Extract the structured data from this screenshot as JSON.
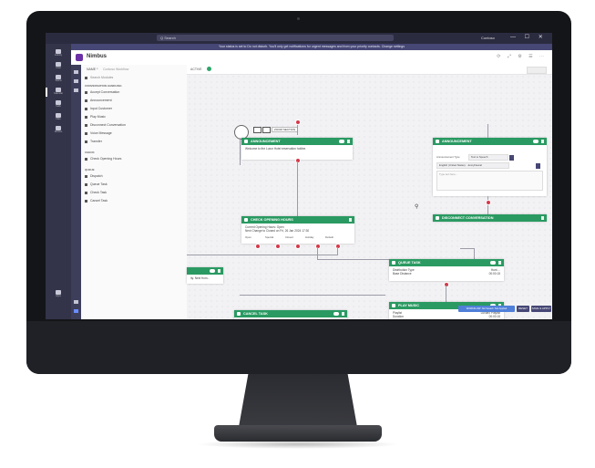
{
  "titlebar": {
    "search_placeholder": "Q Search",
    "user": "Contoso",
    "window_buttons": "— ☐ ✕"
  },
  "banner": {
    "text": "Your status is set to Do not disturb. You'll only get notifications for urgent messages and from your priority contacts. Change settings"
  },
  "app": {
    "name": "Nimbus",
    "header_icons": "⟳ ⤢ ⚙ ☰ ⋯"
  },
  "rail": {
    "items": [
      "Activity",
      "Chat",
      "Teams",
      "Calendar",
      "Calls",
      "Files",
      "Nimbus",
      "Apps"
    ]
  },
  "toolbar": {
    "active_label": "ACTIVE",
    "name_label": "NAME *",
    "name_value": "Contoso Workflow"
  },
  "sidebar": {
    "search_placeholder": "Search Modules",
    "sections": [
      {
        "title": "CONVERSATION HANDLING",
        "items": [
          "Accept Conversation",
          "Announcement",
          "Input Customer",
          "Play Music",
          "Disconnect Conversation",
          "Voice Message",
          "Transfer"
        ]
      },
      {
        "title": "CHECK",
        "items": [
          "Check Opening Hours"
        ]
      },
      {
        "title": "QUEUE",
        "items": [
          "Dispatch",
          "Queue Task",
          "Check Task",
          "Cancel Task"
        ]
      }
    ]
  },
  "nodes": {
    "start_zoom": "ZOOM SECTION",
    "announcement1": {
      "title": "ANNOUNCEMENT",
      "body": "Welcome to the Luxor Hotel reservation hotline."
    },
    "announcement2": {
      "title": "ANNOUNCEMENT",
      "type_label": "Announcement Type",
      "type_value": "Text to Speech",
      "lang_value": "English (United States) · JennyNeural",
      "placeholder": "Type text here..."
    },
    "opening_hours": {
      "title": "CHECK OPENING HOURS",
      "line1": "Current Opening Hours: Open",
      "line2": "Next Change to Closed on Fri, 26 Jan 2024 17:30",
      "outputs": [
        "Open",
        "Special",
        "Closed",
        "Holiday",
        "Default"
      ]
    },
    "partial_node": {
      "body": "ity. Next from..."
    },
    "disconnect": {
      "title": "DISCONNECT CONVERSATION"
    },
    "queue_task": {
      "title": "QUEUE TASK",
      "row1_label": "Distribution Type",
      "row1_value": "Hunt ...",
      "row2_label": "Base Distance",
      "row2_value": "00:00:15"
    },
    "play_music": {
      "title": "PLAY MUSIC",
      "row1_label": "Playlist",
      "row1_value": "Luxurio Playlist",
      "row2_label": "Duration",
      "row2_value": "00:00:15"
    },
    "cancel_task": {
      "title": "CANCEL TASK"
    }
  },
  "footer": {
    "info_button": "WORKFLOW: Not Saved / Not Applied",
    "reset_button": "RESET",
    "save_button": "SAVE & APPLY"
  },
  "colors": {
    "node_header": "#2a9a62",
    "port": "#d3394a",
    "teams_rail": "#33344a",
    "accent": "#464775"
  }
}
